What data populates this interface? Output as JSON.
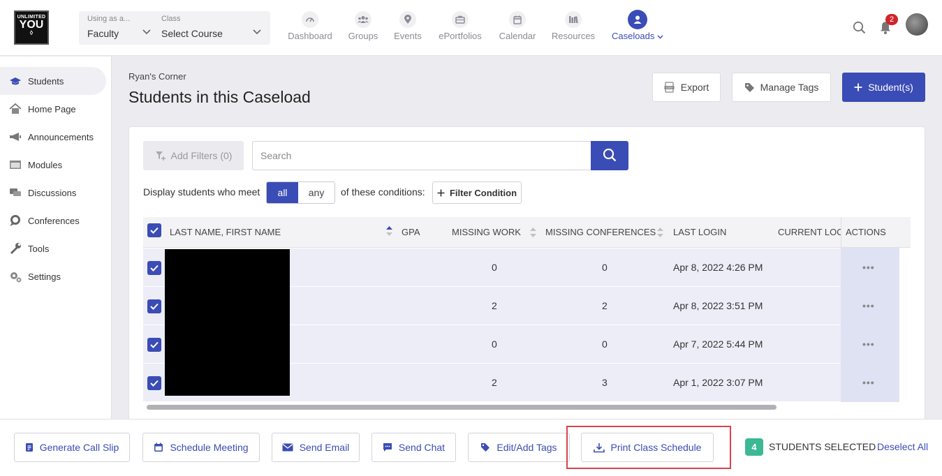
{
  "logo": {
    "line1": "UNLIMITED",
    "line2": "YOU",
    "line3": "◊"
  },
  "context": {
    "using_as_caption": "Using as a...",
    "using_as_value": "Faculty",
    "class_caption": "Class",
    "class_value": "Select Course"
  },
  "nav": [
    {
      "label": "Dashboard",
      "icon": "gauge-icon"
    },
    {
      "label": "Groups",
      "icon": "groups-icon"
    },
    {
      "label": "Events",
      "icon": "map-pin-icon"
    },
    {
      "label": "ePortfolios",
      "icon": "briefcase-icon"
    },
    {
      "label": "Calendar",
      "icon": "calendar-icon"
    },
    {
      "label": "Resources",
      "icon": "books-icon"
    },
    {
      "label": "Caseloads",
      "icon": "user-circle-icon",
      "active": true
    }
  ],
  "notifications": {
    "count": "2"
  },
  "sidebar": [
    {
      "label": "Students",
      "icon": "graduation-cap-icon",
      "active": true
    },
    {
      "label": "Home Page",
      "icon": "home-icon"
    },
    {
      "label": "Announcements",
      "icon": "megaphone-icon"
    },
    {
      "label": "Modules",
      "icon": "window-icon"
    },
    {
      "label": "Discussions",
      "icon": "chat-bubbles-icon"
    },
    {
      "label": "Conferences",
      "icon": "speech-icon"
    },
    {
      "label": "Tools",
      "icon": "wrench-icon"
    },
    {
      "label": "Settings",
      "icon": "gears-icon"
    }
  ],
  "page": {
    "breadcrumb": "Ryan's Corner",
    "title": "Students in this Caseload",
    "export_label": "Export",
    "manage_tags_label": "Manage Tags",
    "add_students_label": "Student(s)"
  },
  "filters": {
    "add_filters_label": "Add Filters (0)",
    "search_placeholder": "Search",
    "display_prefix": "Display students who meet",
    "toggle_all": "all",
    "toggle_any": "any",
    "display_suffix": "of these conditions:",
    "filter_condition_label": "Filter Condition"
  },
  "table": {
    "columns": [
      "LAST NAME, FIRST NAME",
      "GPA",
      "MISSING WORK",
      "MISSING CONFERENCES",
      "LAST LOGIN",
      "CURRENT LOCA",
      "ACTIONS"
    ],
    "rows": [
      {
        "gpa": "",
        "missing_work": "0",
        "missing_conferences": "0",
        "last_login": "Apr 8, 2022 4:26 PM",
        "actions": "•••"
      },
      {
        "gpa": "",
        "missing_work": "2",
        "missing_conferences": "2",
        "last_login": "Apr 8, 2022 3:51 PM",
        "actions": "•••"
      },
      {
        "gpa": "",
        "missing_work": "0",
        "missing_conferences": "0",
        "last_login": "Apr 7, 2022 5:44 PM",
        "actions": "•••"
      },
      {
        "gpa": "",
        "missing_work": "2",
        "missing_conferences": "3",
        "last_login": "Apr 1, 2022 3:07 PM",
        "actions": "•••"
      }
    ]
  },
  "bottom": {
    "generate_call_slip": "Generate Call Slip",
    "schedule_meeting": "Schedule Meeting",
    "send_email": "Send Email",
    "send_chat": "Send Chat",
    "edit_add_tags": "Edit/Add Tags",
    "print_class_schedule": "Print Class Schedule",
    "selected_count": "4",
    "selected_text": "STUDENTS SELECTED",
    "deselect_all": "Deselect All"
  },
  "colors": {
    "primary": "#3a4cb5",
    "highlight": "#d9434b",
    "badge_green": "#3cb895",
    "notification_red": "#d0252a"
  }
}
